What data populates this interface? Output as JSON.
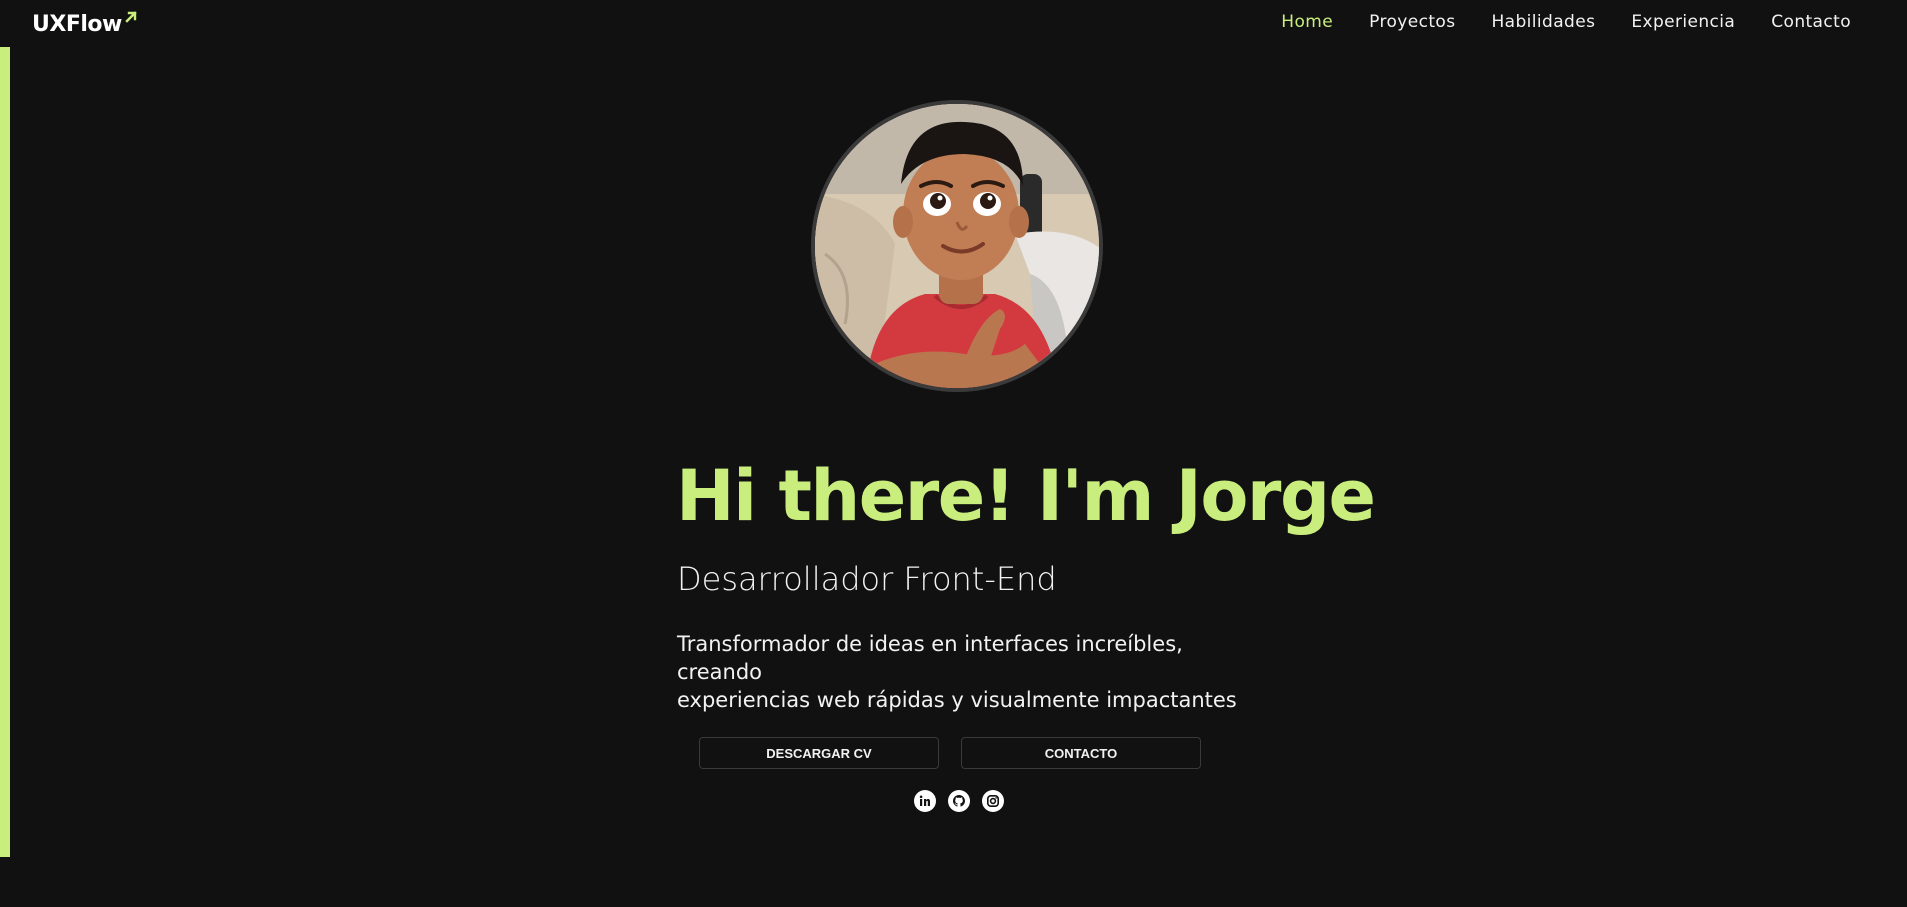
{
  "header": {
    "logo_text": "UXFlow",
    "nav": [
      {
        "label": "Home",
        "active": true
      },
      {
        "label": "Proyectos",
        "active": false
      },
      {
        "label": "Habilidades",
        "active": false
      },
      {
        "label": "Experiencia",
        "active": false
      },
      {
        "label": "Contacto",
        "active": false
      }
    ]
  },
  "hero": {
    "greeting": "Hi there! I'm Jorge",
    "role": "Desarrollador Front-End",
    "tagline_line1": "Transformador de ideas en interfaces increíbles, creando",
    "tagline_line2": "experiencias web rápidas y visualmente impactantes",
    "buttons": {
      "cv": "DESCARGAR CV",
      "contact": "CONTACTO"
    },
    "socials": [
      {
        "icon": "linkedin-icon"
      },
      {
        "icon": "github-icon"
      },
      {
        "icon": "instagram-icon"
      }
    ]
  },
  "colors": {
    "accent": "#c9ee7e",
    "background": "#111111",
    "text": "#f2f2f2"
  }
}
